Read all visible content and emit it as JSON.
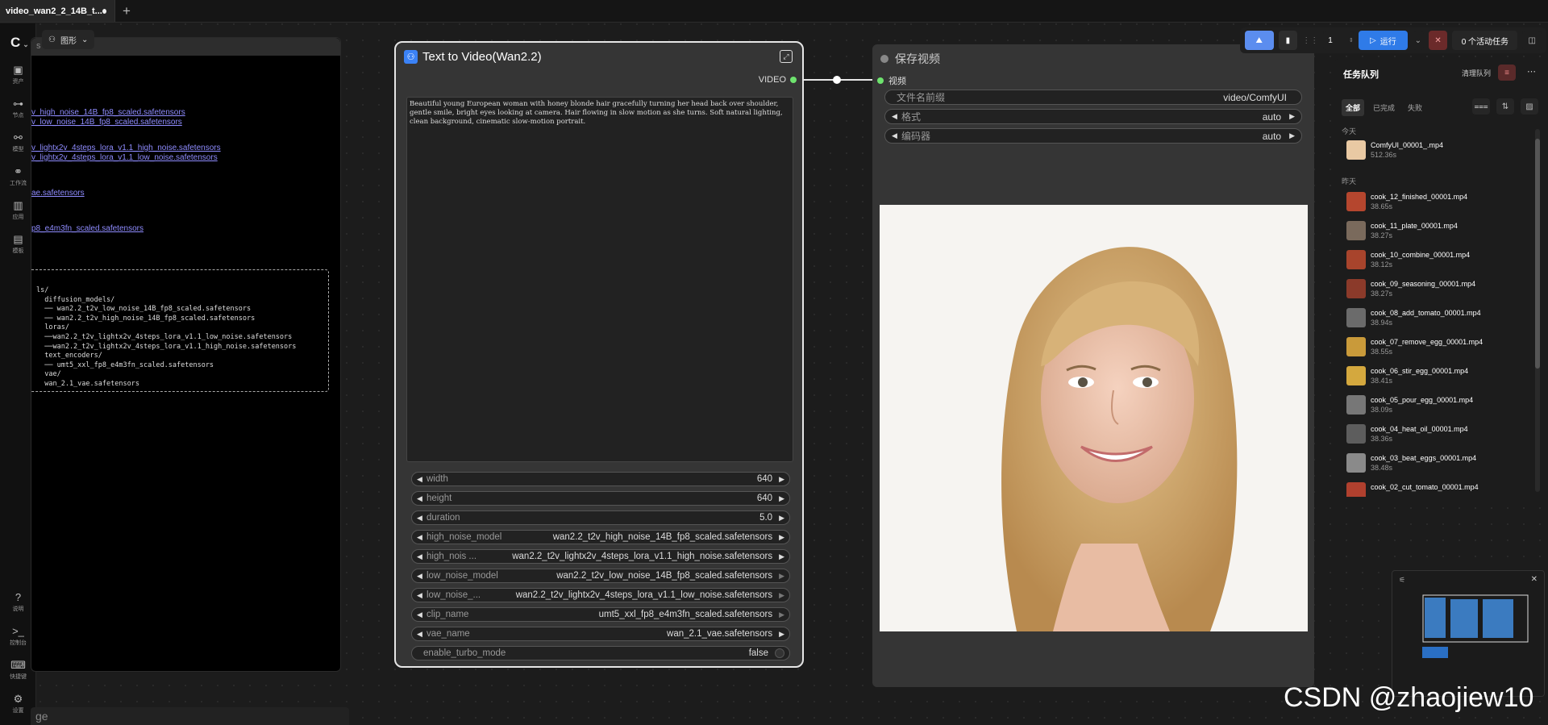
{
  "tabs": [
    {
      "label": "video_wan2_2_14B_t..."
    }
  ],
  "sidebar": {
    "logo_suffix": "s",
    "items": [
      {
        "label": "资产"
      },
      {
        "label": "节点"
      },
      {
        "label": "模型"
      },
      {
        "label": "工作流"
      },
      {
        "label": "应用"
      },
      {
        "label": "模板"
      },
      {
        "label": "说明"
      },
      {
        "label": "控制台"
      },
      {
        "label": "快捷键"
      },
      {
        "label": "设置"
      }
    ]
  },
  "graph_toolbar": {
    "label": "图形"
  },
  "note": {
    "links": [
      "v_high_noise_14B_fp8_scaled.safetensors",
      "v_low_noise_14B_fp8_scaled.safetensors",
      "v_lightx2v_4steps_lora_v1.1_high_noise.safetensors",
      "v_lightx2v_4steps_lora_v1.1_low_noise.safetensors",
      "ae.safetensors",
      "p8_e4m3fn_scaled.safetensors"
    ],
    "tree": [
      "ls/",
      "  diffusion_models/",
      "  ── wan2.2_t2v_low_noise_14B_fp8_scaled.safetensors",
      "  ── wan2.2_t2v_high_noise_14B_fp8_scaled.safetensors",
      "  loras/",
      "  ──wan2.2_t2v_lightx2v_4steps_lora_v1.1_low_noise.safetensors",
      "  ──wan2.2_t2v_lightx2v_4steps_lora_v1.1_high_noise.safetensors",
      "  text_encoders/",
      "  ── umt5_xxl_fp8_e4m3fn_scaled.safetensors",
      "  vae/",
      "  wan_2.1_vae.safetensors"
    ],
    "bottom_text": "ge"
  },
  "t2v_node": {
    "title": "Text to Video(Wan2.2)",
    "output_label": "VIDEO",
    "prompt": "Beautiful young European woman with honey blonde hair gracefully turning her head back over shoulder, gentle smile, bright eyes looking at camera. Hair flowing in slow motion as she turns. Soft natural lighting, clean background, cinematic slow-motion portrait.",
    "widgets": [
      {
        "name": "width",
        "value": "640"
      },
      {
        "name": "height",
        "value": "640"
      },
      {
        "name": "duration",
        "value": "5.0"
      },
      {
        "name": "high_noise_model",
        "value": "wan2.2_t2v_high_noise_14B_fp8_scaled.safetensors"
      },
      {
        "name": "high_nois ...",
        "value": "wan2.2_t2v_lightx2v_4steps_lora_v1.1_high_noise.safetensors"
      },
      {
        "name": "low_noise_model",
        "value": "wan2.2_t2v_low_noise_14B_fp8_scaled.safetensors"
      },
      {
        "name": "low_noise_...",
        "value": "wan2.2_t2v_lightx2v_4steps_lora_v1.1_low_noise.safetensors"
      },
      {
        "name": "clip_name",
        "value": "umt5_xxl_fp8_e4m3fn_scaled.safetensors"
      },
      {
        "name": "vae_name",
        "value": "wan_2.1_vae.safetensors"
      }
    ],
    "turbo": {
      "name": "enable_turbo_mode",
      "value": "false"
    }
  },
  "save_node": {
    "title": "保存视频",
    "input_label": "视频",
    "widgets": [
      {
        "name": "文件名前缀",
        "value": "video/ComfyUI"
      },
      {
        "name": "格式",
        "value": "auto"
      },
      {
        "name": "编码器",
        "value": "auto"
      }
    ]
  },
  "runbar": {
    "batch_count": "1",
    "run_label": "运行",
    "active_tasks": "0 个活动任务"
  },
  "queue": {
    "title": "任务队列",
    "clear_label": "清理队列",
    "tabs": [
      "全部",
      "已完成",
      "失败"
    ],
    "section_today": "今天",
    "section_yesterday": "昨天",
    "today": [
      {
        "name": "ComfyUI_00001_.mp4",
        "time": "512.36s"
      }
    ],
    "yesterday": [
      {
        "name": "cook_12_finished_00001.mp4",
        "time": "38.65s"
      },
      {
        "name": "cook_11_plate_00001.mp4",
        "time": "38.27s"
      },
      {
        "name": "cook_10_combine_00001.mp4",
        "time": "38.12s"
      },
      {
        "name": "cook_09_seasoning_00001.mp4",
        "time": "38.27s"
      },
      {
        "name": "cook_08_add_tomato_00001.mp4",
        "time": "38.94s"
      },
      {
        "name": "cook_07_remove_egg_00001.mp4",
        "time": "38.55s"
      },
      {
        "name": "cook_06_stir_egg_00001.mp4",
        "time": "38.41s"
      },
      {
        "name": "cook_05_pour_egg_00001.mp4",
        "time": "38.09s"
      },
      {
        "name": "cook_04_heat_oil_00001.mp4",
        "time": "38.36s"
      },
      {
        "name": "cook_03_beat_eggs_00001.mp4",
        "time": "38.48s"
      },
      {
        "name": "cook_02_cut_tomato_00001.mp4",
        "time": ""
      }
    ]
  },
  "watermark": "CSDN @zhaojiew10",
  "colors": {
    "accent": "#3b82f6",
    "connector": "#6ee36e",
    "link": "#8f8cff"
  }
}
